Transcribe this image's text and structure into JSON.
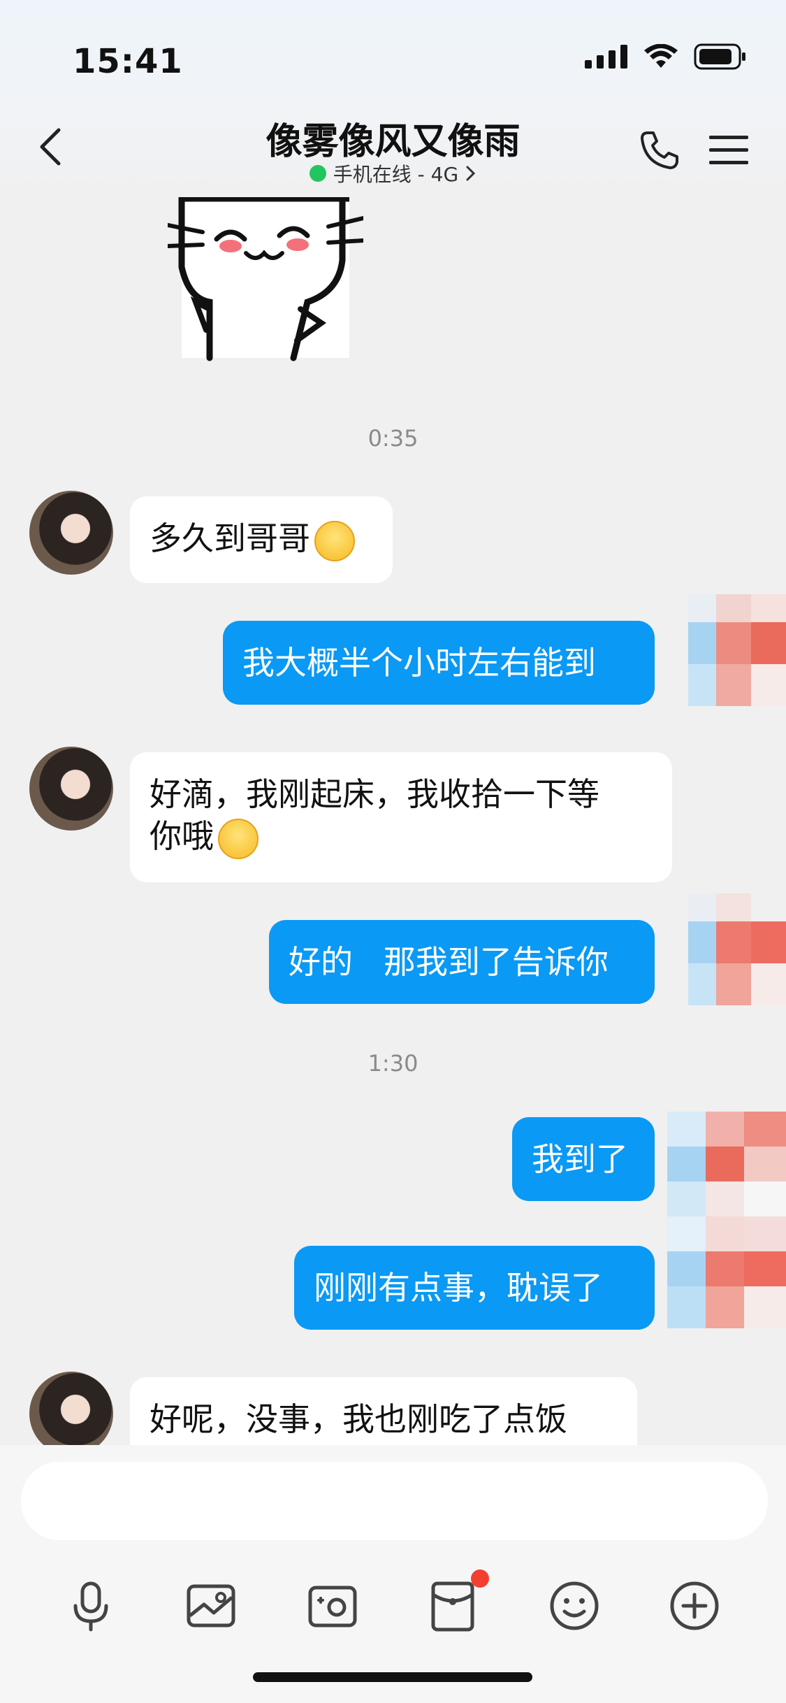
{
  "status_bar": {
    "time": "15:41"
  },
  "header": {
    "title": "像雾像风又像雨",
    "status": "手机在线 - 4G",
    "online_color": "#22c55e"
  },
  "messages": {
    "time_1": "0:35",
    "m1": "多久到哥哥",
    "m2": "我大概半个小时左右能到",
    "m3_line1": "好滴，我刚起床，我收拾一下等",
    "m3_line2": "你哦",
    "m4": "好的   那我到了告诉你",
    "time_2": "1:30",
    "m5": "我到了",
    "m6": "刚刚有点事，耽误了",
    "m7": "好呢，没事，我也刚吃了点饭"
  },
  "input": {
    "placeholder": ""
  },
  "toolbar": {
    "icons": [
      "microphone-icon",
      "image-icon",
      "camera-icon",
      "red-packet-icon",
      "emoji-icon",
      "plus-icon"
    ],
    "badge_color": "#f43f30"
  },
  "colors": {
    "outgoing_bubble": "#0a99f5",
    "incoming_bubble": "#ffffff",
    "background": "#f0f0f0"
  }
}
